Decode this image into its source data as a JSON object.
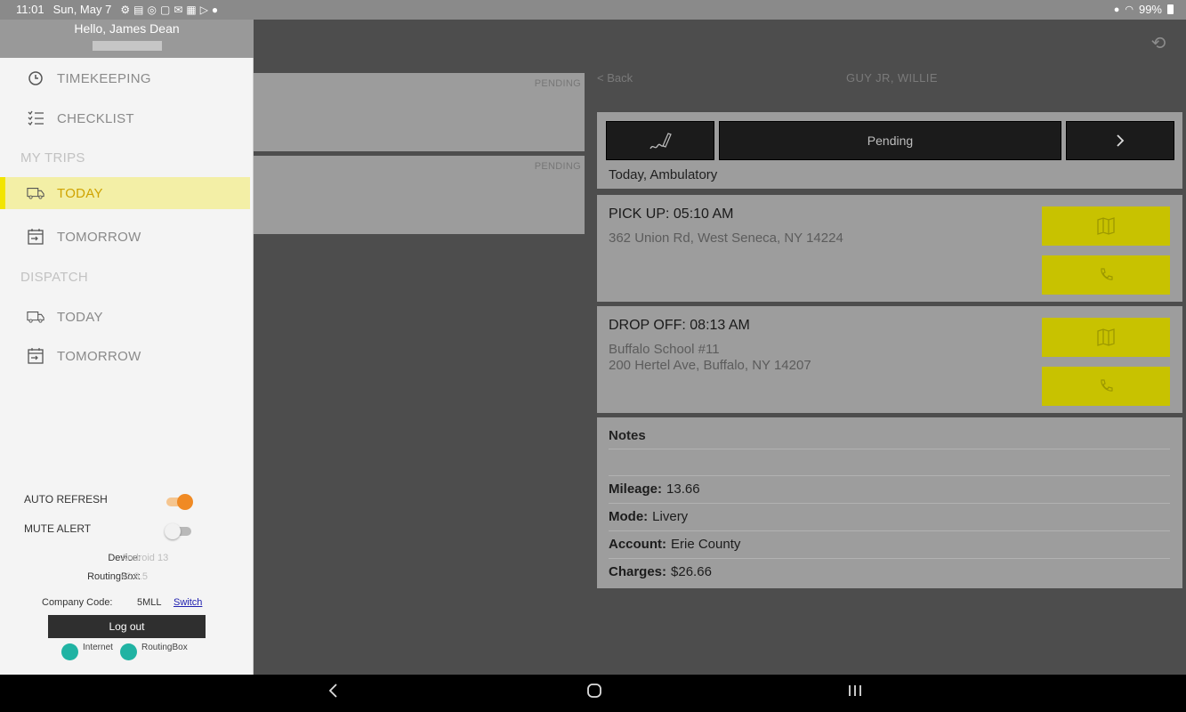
{
  "status_bar": {
    "time": "11:01",
    "date": "Sun, May 7",
    "battery": "99%"
  },
  "drawer": {
    "greeting": "Hello, James Dean",
    "nav": {
      "timekeeping": "TIMEKEEPING",
      "checklist": "CHECKLIST",
      "my_trips_section": "MY TRIPS",
      "my_trips_today": "TODAY",
      "my_trips_tomorrow": "TOMORROW",
      "dispatch_section": "DISPATCH",
      "dispatch_today": "TODAY",
      "dispatch_tomorrow": "TOMORROW"
    },
    "settings": {
      "auto_refresh_label": "AUTO REFRESH",
      "auto_refresh_on": true,
      "mute_alert_label": "MUTE ALERT",
      "mute_alert_on": false
    },
    "info": {
      "device_label": "Device:",
      "device_value": "Android 13",
      "routingbox_label": "RoutingBox:",
      "routingbox_value": "v2.8.5",
      "company_code_label": "Company Code:",
      "company_code_value": "5MLL",
      "switch_link": "Switch"
    },
    "logout_label": "Log out",
    "connections": {
      "internet": "Internet",
      "routingbox": "RoutingBox"
    },
    "accent_color": "#f2e500",
    "toggle_on_color": "#f08a24"
  },
  "trip_list": [
    {
      "status": "PENDING"
    },
    {
      "status": "PENDING"
    }
  ],
  "detail": {
    "back_label": "< Back",
    "passenger_name": "GUY  JR, WILLIE",
    "status_button": "Pending",
    "trip_subtitle": "Today, Ambulatory",
    "pickup": {
      "heading": "PICK UP: 05:10 AM",
      "address": "362 Union Rd, West Seneca, NY 14224"
    },
    "dropoff": {
      "heading": "DROP OFF: 08:13 AM",
      "place": "Buffalo School #11",
      "address": "200 Hertel Ave, Buffalo, NY 14207"
    },
    "notes": {
      "title": "Notes",
      "mileage_label": "Mileage:",
      "mileage_value": "13.66",
      "mode_label": "Mode:",
      "mode_value": "Livery",
      "account_label": "Account:",
      "account_value": "Erie County",
      "charges_label": "Charges:",
      "charges_value": "$26.66"
    },
    "action_color": "#c8c200"
  }
}
